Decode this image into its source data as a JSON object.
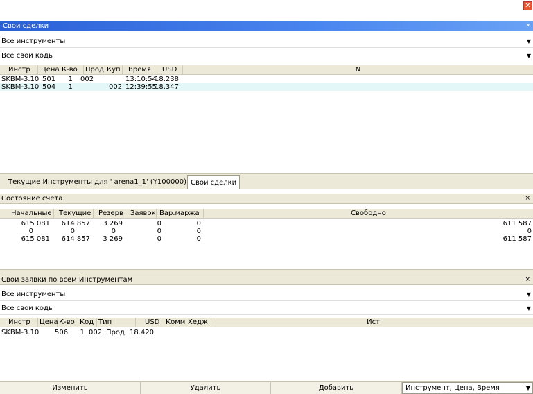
{
  "window": {
    "close_glyph": "✕"
  },
  "deals_panel": {
    "title": "Свои сделки",
    "close_glyph": "×",
    "instrument_filter": "Все инструменты",
    "code_filter": "Все свои коды",
    "columns": [
      "Инстр",
      "Цена",
      "К-во",
      "Прод",
      "Куп",
      "Время",
      "USD",
      "N"
    ],
    "rows": [
      {
        "instr": "SKBM-3.10",
        "price": "501",
        "qty": "1",
        "sell": "002",
        "buy": "",
        "time": "13:10:54",
        "usd": "18.238"
      },
      {
        "instr": "SKBM-3.10",
        "price": "504",
        "qty": "1",
        "sell": "",
        "buy": "002",
        "time": "12:39:55",
        "usd": "18.347"
      }
    ]
  },
  "tabs": {
    "instruments": "Текущие Инструменты для ' arena1_1'  (Y100000)",
    "own_deals": "Свои сделки"
  },
  "account_panel": {
    "title": "Состояние счета",
    "close_glyph": "×",
    "columns": [
      "Начальные",
      "Текущие",
      "Резерв",
      "Заявок",
      "Вар.маржа",
      "Свободно"
    ],
    "rows": [
      {
        "initial": "615 081",
        "current": "614 857",
        "reserve": "3 269",
        "orders": "0",
        "var_margin": "0",
        "free": "611 587"
      },
      {
        "initial": "0",
        "current": "0",
        "reserve": "0",
        "orders": "0",
        "var_margin": "0",
        "free": "0"
      },
      {
        "initial": "615 081",
        "current": "614 857",
        "reserve": "3 269",
        "orders": "0",
        "var_margin": "0",
        "free": "611 587"
      }
    ]
  },
  "orders_panel": {
    "title": "Свои заявки по всем Инструментам",
    "close_glyph": "×",
    "instrument_filter": "Все инструменты",
    "code_filter": "Все свои коды",
    "columns": [
      "Инстр",
      "Цена",
      "К-во",
      "Код",
      "Тип",
      "USD",
      "Комм",
      "Хедж",
      "Ист"
    ],
    "rows": [
      {
        "instr": "SKBM-3.10",
        "price": "506",
        "qty": "1",
        "code": "002",
        "type": "Прод",
        "usd": "18.420"
      }
    ]
  },
  "actions": {
    "edit": "Изменить",
    "delete": "Удалить",
    "add": "Добавить",
    "sort_value": "Инструмент, Цена, Время"
  },
  "icons": {
    "dropdown_arrow": "▼",
    "close": "close-icon"
  },
  "colors": {
    "title_bar": "#2a5fd6",
    "selected_row": "#e3f7f9",
    "close_button": "#e7562f"
  }
}
